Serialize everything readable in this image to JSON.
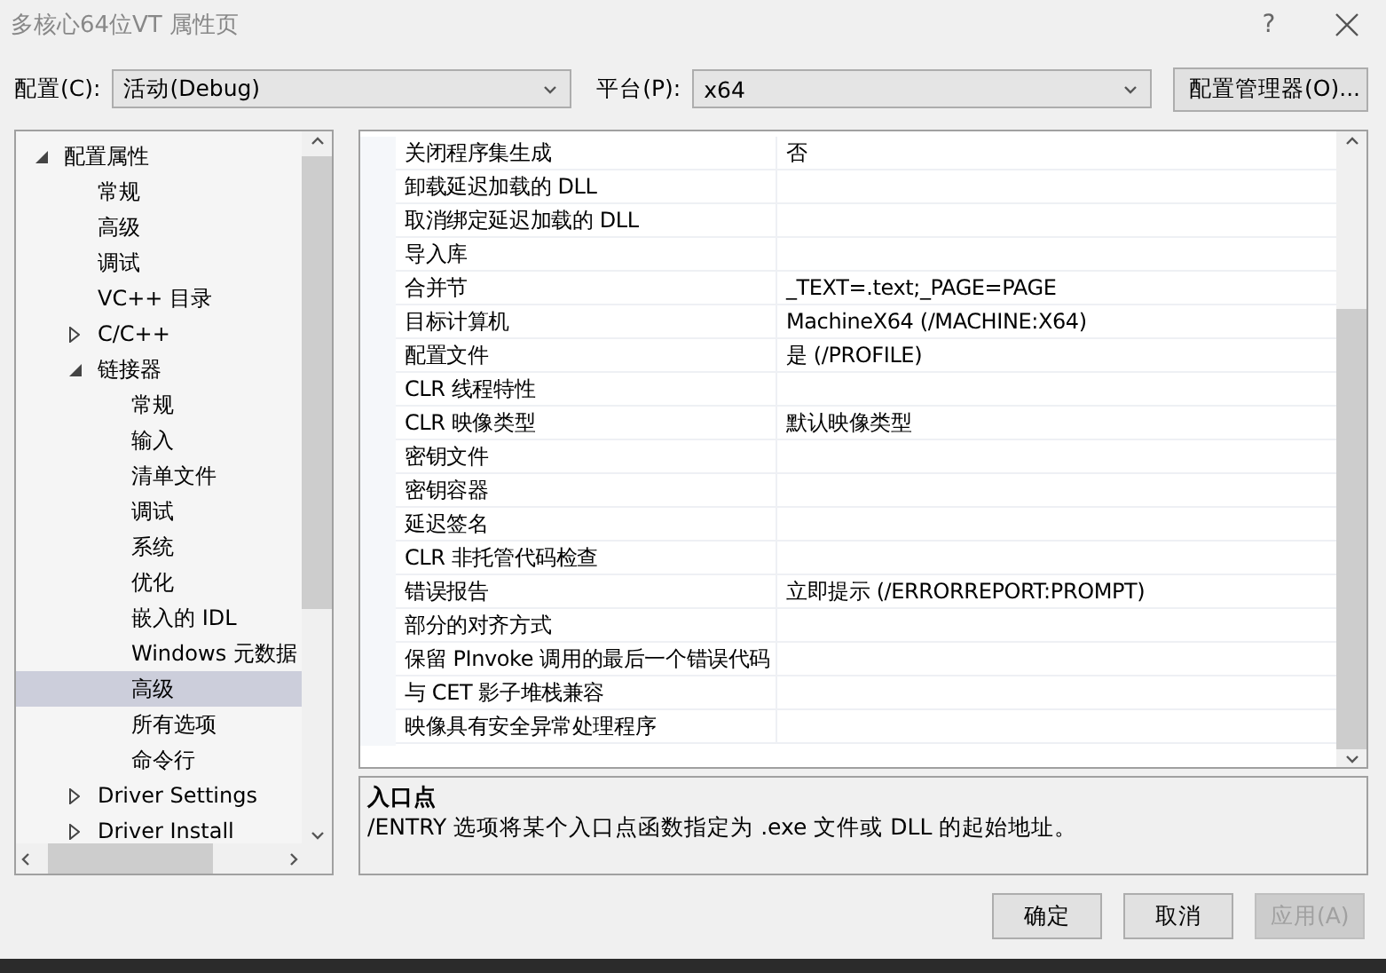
{
  "window": {
    "title": "多核心64位VT 属性页",
    "help": "?"
  },
  "config": {
    "label": "配置(C):",
    "value": "活动(Debug)"
  },
  "platform": {
    "label": "平台(P):",
    "value": "x64"
  },
  "config_manager_button": "配置管理器(O)...",
  "tree": [
    {
      "label": "配置属性",
      "expanded": true,
      "selected": false,
      "children": [
        {
          "label": "常规",
          "selected": false
        },
        {
          "label": "高级",
          "selected": false
        },
        {
          "label": "调试",
          "selected": false
        },
        {
          "label": "VC++ 目录",
          "selected": false
        },
        {
          "label": "C/C++",
          "expanded": false,
          "selected": false
        },
        {
          "label": "链接器",
          "expanded": true,
          "selected": false,
          "children": [
            {
              "label": "常规",
              "selected": false
            },
            {
              "label": "输入",
              "selected": false
            },
            {
              "label": "清单文件",
              "selected": false
            },
            {
              "label": "调试",
              "selected": false
            },
            {
              "label": "系统",
              "selected": false
            },
            {
              "label": "优化",
              "selected": false
            },
            {
              "label": "嵌入的 IDL",
              "selected": false
            },
            {
              "label": "Windows 元数据",
              "selected": false
            },
            {
              "label": "高级",
              "selected": true
            },
            {
              "label": "所有选项",
              "selected": false
            },
            {
              "label": "命令行",
              "selected": false
            }
          ]
        },
        {
          "label": "Driver Settings",
          "expanded": false,
          "selected": false
        },
        {
          "label": "Driver Install",
          "expanded": false,
          "selected": false
        }
      ]
    }
  ],
  "properties": [
    {
      "name": "关闭程序集生成",
      "value": "否"
    },
    {
      "name": "卸载延迟加载的 DLL"
    },
    {
      "name": "取消绑定延迟加载的 DLL"
    },
    {
      "name": "导入库"
    },
    {
      "name": "合并节",
      "value": "_TEXT=.text;_PAGE=PAGE"
    },
    {
      "name": "目标计算机",
      "value": "MachineX64 (/MACHINE:X64)"
    },
    {
      "name": "配置文件",
      "value": "是 (/PROFILE)"
    },
    {
      "name": "CLR 线程特性"
    },
    {
      "name": "CLR 映像类型",
      "value": "默认映像类型"
    },
    {
      "name": "密钥文件"
    },
    {
      "name": "密钥容器"
    },
    {
      "name": "延迟签名"
    },
    {
      "name": "CLR 非托管代码检查"
    },
    {
      "name": "错误报告",
      "value": "立即提示 (/ERRORREPORT:PROMPT)"
    },
    {
      "name": "部分的对齐方式"
    },
    {
      "name": "保留 PInvoke 调用的最后一个错误代码"
    },
    {
      "name": "与 CET 影子堆栈兼容"
    },
    {
      "name": "映像具有安全异常处理程序"
    }
  ],
  "description": {
    "title": "入口点",
    "text": "/ENTRY 选项将某个入口点函数指定为 .exe 文件或 DLL 的起始地址。"
  },
  "buttons": [
    {
      "label": "确定",
      "disabled": false
    },
    {
      "label": "取消",
      "disabled": false
    },
    {
      "label": "应用(A)",
      "disabled": true
    }
  ]
}
